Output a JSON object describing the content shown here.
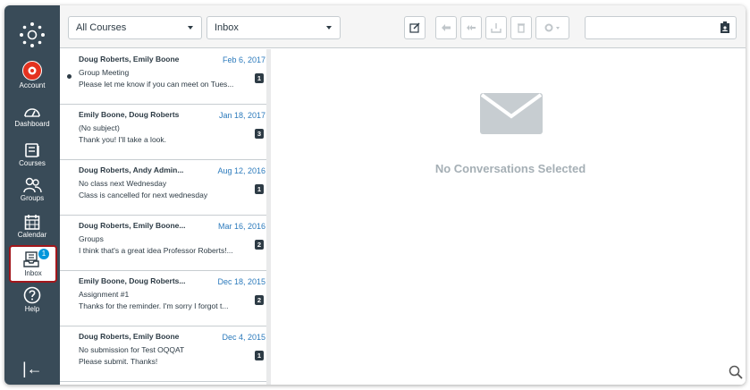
{
  "nav": {
    "items": [
      {
        "label": "Account",
        "icon": "account-icon"
      },
      {
        "label": "Dashboard",
        "icon": "dashboard-icon"
      },
      {
        "label": "Courses",
        "icon": "courses-icon"
      },
      {
        "label": "Groups",
        "icon": "groups-icon"
      },
      {
        "label": "Calendar",
        "icon": "calendar-icon"
      },
      {
        "label": "Inbox",
        "icon": "inbox-icon",
        "badge": "1"
      },
      {
        "label": "Help",
        "icon": "help-icon"
      }
    ],
    "collapse_glyph": "|←"
  },
  "toolbar": {
    "course_filter": "All Courses",
    "mailbox_filter": "Inbox",
    "search_placeholder": ""
  },
  "conversations": [
    {
      "names": "Doug Roberts, Emily Boone",
      "date": "Feb 6, 2017",
      "subject": "Group Meeting",
      "snippet": "Please let me know if you can meet on Tues...",
      "count": "1",
      "unread": true
    },
    {
      "names": "Emily Boone, Doug Roberts",
      "date": "Jan 18, 2017",
      "subject": "(No subject)",
      "snippet": "Thank you! I'll take a look.",
      "count": "3",
      "unread": false
    },
    {
      "names": "Doug Roberts, Andy Admin...",
      "date": "Aug 12, 2016",
      "subject": "No class next Wednesday",
      "snippet": "Class is cancelled for next wednesday",
      "count": "1",
      "unread": false
    },
    {
      "names": "Doug Roberts, Emily Boone...",
      "date": "Mar 16, 2016",
      "subject": "Groups",
      "snippet": "I think that's a great idea Professor Roberts!...",
      "count": "2",
      "unread": false
    },
    {
      "names": "Emily Boone, Doug Roberts...",
      "date": "Dec 18, 2015",
      "subject": "Assignment #1",
      "snippet": "Thanks for the reminder. I'm sorry I forgot t...",
      "count": "2",
      "unread": false
    },
    {
      "names": "Doug Roberts, Emily Boone",
      "date": "Dec 4, 2015",
      "subject": "No submission for Test OQQAT",
      "snippet": "Please submit. Thanks!",
      "count": "1",
      "unread": false
    }
  ],
  "detail": {
    "empty_message": "No Conversations Selected"
  },
  "colors": {
    "nav_bg": "#394b58",
    "link_blue": "#2b7abc",
    "active_border": "#a3161b",
    "badge_blue": "#0096db",
    "account_red": "#e4321f"
  }
}
